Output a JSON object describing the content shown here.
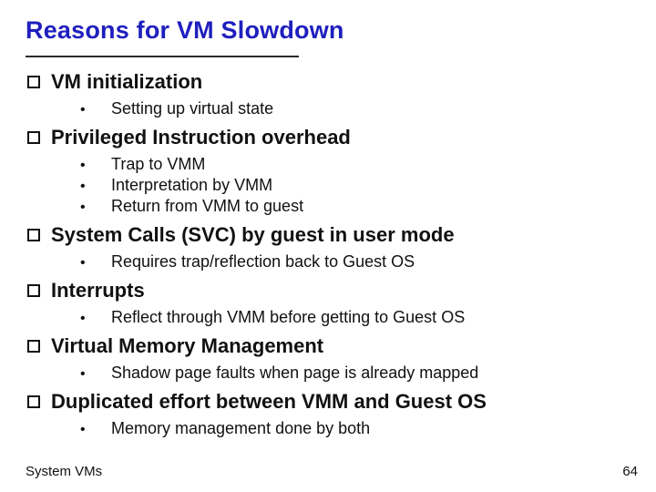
{
  "title": "Reasons for VM Slowdown",
  "sections": [
    {
      "heading": "VM initialization",
      "items": [
        "Setting up virtual state"
      ]
    },
    {
      "heading": "Privileged Instruction overhead",
      "items": [
        "Trap to VMM",
        "Interpretation by VMM",
        "Return from VMM to guest"
      ]
    },
    {
      "heading": "System Calls (SVC) by guest in user mode",
      "items": [
        "Requires trap/reflection back to Guest OS"
      ]
    },
    {
      "heading": "Interrupts",
      "items": [
        "Reflect through VMM before getting to Guest OS"
      ]
    },
    {
      "heading": "Virtual Memory Management",
      "items": [
        "Shadow page faults when page is already mapped"
      ]
    },
    {
      "heading": "Duplicated effort between VMM and Guest OS",
      "items": [
        "Memory management done by both"
      ]
    }
  ],
  "footer": {
    "text": "System VMs",
    "page": "64"
  }
}
